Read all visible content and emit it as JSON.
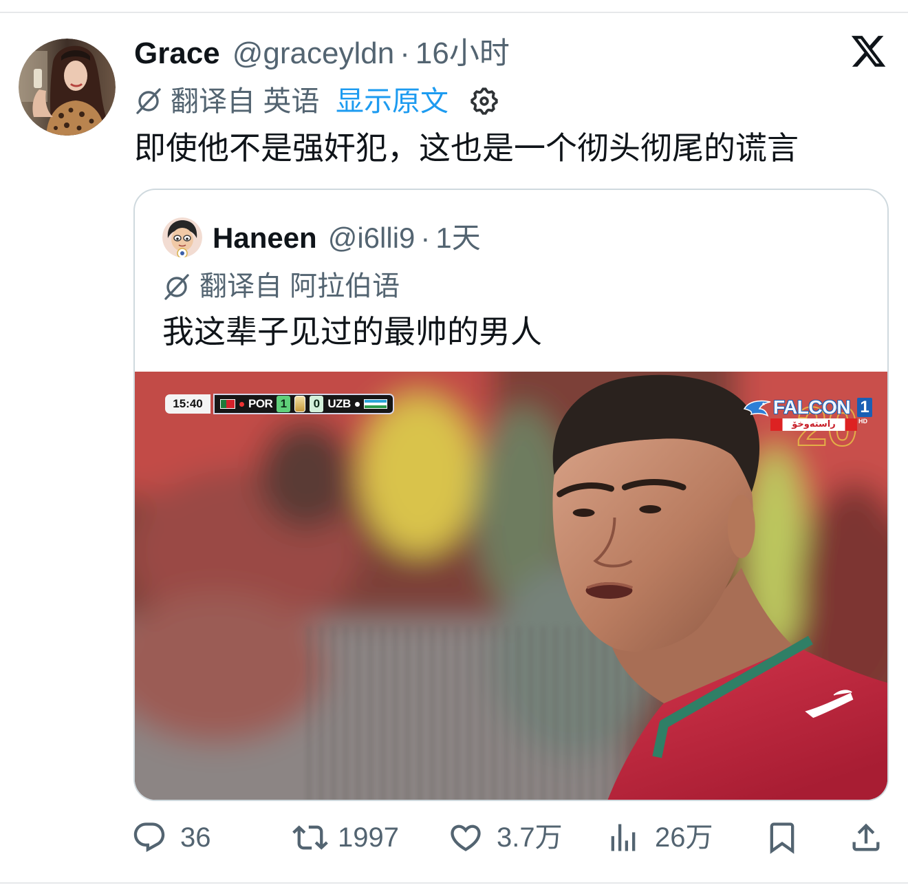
{
  "app": {
    "logo_icon": "x-logo-icon"
  },
  "tweet": {
    "author": {
      "name": "Grace",
      "handle": "@graceyldn",
      "separator": "·",
      "time": "16小时"
    },
    "translation": {
      "label": "翻译自 英语",
      "show_original": "显示原文",
      "icon": "translate-icon",
      "settings_icon": "gear-icon"
    },
    "text": "即使他不是强奸犯，这也是一个彻头彻尾的谎言",
    "quoted": {
      "author": {
        "name": "Haneen",
        "handle": "@i6lli9",
        "separator": "·",
        "time": "1天"
      },
      "translation": {
        "label": "翻译自 阿拉伯语",
        "icon": "translate-icon"
      },
      "text": "我这辈子见过的最帅的男人",
      "media": {
        "scoreboard": {
          "clock": "15:40",
          "home": "POR",
          "home_score": "1",
          "away_score": "0",
          "away": "UZB"
        },
        "channel_logo": {
          "name": "FALCON",
          "number": "1",
          "tag": "HD",
          "subtitle": "راستەوخۆ",
          "watermark": "20"
        }
      }
    },
    "actions": {
      "reply": {
        "icon": "reply-icon",
        "count": "36"
      },
      "retweet": {
        "icon": "retweet-icon",
        "count": "1997"
      },
      "like": {
        "icon": "heart-icon",
        "count": "3.7万"
      },
      "views": {
        "icon": "views-icon",
        "count": "26万"
      },
      "bookmark": {
        "icon": "bookmark-icon"
      },
      "share": {
        "icon": "share-icon"
      }
    }
  },
  "colors": {
    "text": "#0f1419",
    "secondary": "#536471",
    "link": "#1d9bf0",
    "border": "#cfd9de",
    "divider": "#e6e8ea"
  }
}
